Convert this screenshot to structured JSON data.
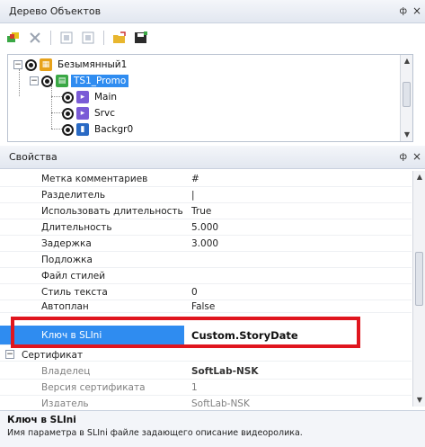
{
  "tree_panel": {
    "title": "Дерево Объектов",
    "pin": "ф",
    "close": "×",
    "nodes": [
      {
        "label": "Безымянный1"
      },
      {
        "label": "TS1_Promo"
      },
      {
        "label": "Main"
      },
      {
        "label": "Srvc"
      },
      {
        "label": "Backgr0"
      }
    ]
  },
  "properties_panel": {
    "title": "Свойства",
    "pin": "ф",
    "close": "×",
    "rows": [
      {
        "name": "Метка комментариев",
        "value": "#"
      },
      {
        "name": "Разделитель",
        "value": "|"
      },
      {
        "name": "Использовать длительность кл",
        "value": "True"
      },
      {
        "name": "Длительность",
        "value": "5.000"
      },
      {
        "name": "Задержка",
        "value": "3.000"
      },
      {
        "name": "Подложка",
        "value": ""
      },
      {
        "name": "Файл стилей",
        "value": ""
      },
      {
        "name": "Стиль текста",
        "value": "0"
      },
      {
        "name": "Автоплан",
        "value": "False"
      },
      {
        "name": "Ключ в SLIni",
        "value": "Custom.StoryDate"
      },
      {
        "name": "Сертификат",
        "value": ""
      },
      {
        "name": "Владелец",
        "value": "SoftLab-NSK"
      },
      {
        "name": "Версия сертификата",
        "value": "1"
      },
      {
        "name": "Издатель",
        "value": "SoftLab-NSK"
      }
    ]
  },
  "description": {
    "title": "Ключ в SLIni",
    "text": "Имя параметра в SLIni файле задающего описание видеоролика."
  },
  "colors": {
    "selection": "#2f8cf0",
    "highlight_box": "#e0161e"
  }
}
